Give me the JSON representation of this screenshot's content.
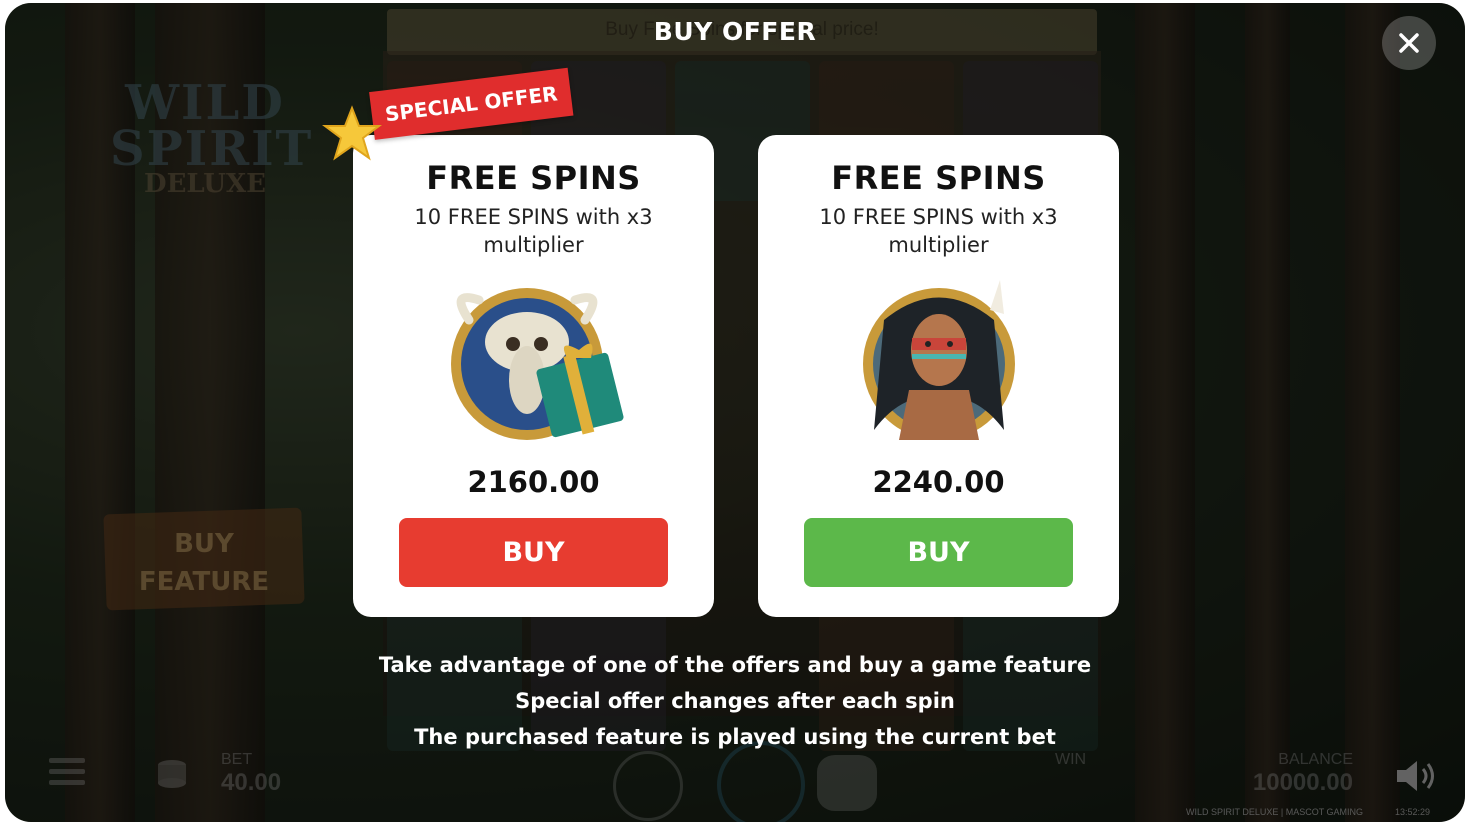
{
  "header": {
    "title": "BUY OFFER",
    "banner_text": "Buy Free Spins for special price!"
  },
  "game_logo": {
    "line1": "WILD",
    "line2": "SPIRIT",
    "line3": "DELUXE"
  },
  "buy_feature_sign": {
    "line1": "BUY",
    "line2": "FEATURE"
  },
  "special_ribbon": "SPECIAL OFFER",
  "offers": [
    {
      "title": "FREE SPINS",
      "description": "10 FREE SPINS with x3 multiplier",
      "price": "2160.00",
      "buy_label": "BUY",
      "button_color": "#e73c30",
      "icon": "buffalo-skull-gift-icon"
    },
    {
      "title": "FREE SPINS",
      "description": "10 FREE SPINS with x3 multiplier",
      "price": "2240.00",
      "buy_label": "BUY",
      "button_color": "#5cb84a",
      "icon": "warrior-portrait-icon"
    }
  ],
  "info_lines": [
    "Take advantage of one of the offers and buy a game feature",
    "Special offer changes after each spin",
    "The purchased feature is played using the current bet"
  ],
  "hud": {
    "bet_label": "BET",
    "bet_value": "40.00",
    "win_label": "WIN",
    "balance_label": "BALANCE",
    "balance_value": "10000.00",
    "footer": "WILD SPIRIT DELUXE | MASCOT GAMING",
    "clock": "13:52:29"
  }
}
